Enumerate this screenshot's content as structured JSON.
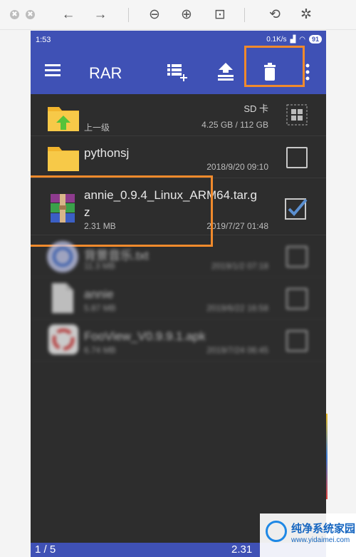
{
  "viewer": {
    "close_icon": "✖",
    "minimize_icon": "✖",
    "back_icon": "←",
    "forward_icon": "→",
    "zoom_out_icon": "⊖",
    "zoom_in_icon": "⊕",
    "fit_icon": "⊡",
    "rotate_icon": "⟲",
    "magic_icon": "✲"
  },
  "status": {
    "time": "1:53",
    "speed": "0.1K/s",
    "battery": "91"
  },
  "app_bar": {
    "title": "RAR",
    "accent_color": "#3f51b5",
    "highlight_color": "#f08a2c"
  },
  "rows": [
    {
      "name": "上一级",
      "right_top": "SD 卡",
      "right_bottom": "4.25 GB / 112 GB"
    },
    {
      "name": "pythonsj",
      "right_bottom": "2018/9/20 09:10"
    },
    {
      "name": "annie_0.9.4_Linux_ARM64.tar.g",
      "name2": "z",
      "size": "2.31 MB",
      "date": "2019/7/27 01:48",
      "checked": true
    },
    {
      "name": "背景音乐.txt",
      "size": "11.3 MB",
      "date": "2019/1/2 07:18"
    },
    {
      "name": "annie",
      "size": "5.87 MB",
      "date": "2019/6/22 16:58"
    },
    {
      "name": "FooView_V0.9.9.1.apk",
      "size": "6.74 MB",
      "date": "2019/7/24 06:45"
    }
  ],
  "bottom": {
    "page": "1 / 5",
    "size": "2.31"
  },
  "watermark": {
    "text": "纯净系统家园",
    "url": "www.yidaimei.com"
  }
}
